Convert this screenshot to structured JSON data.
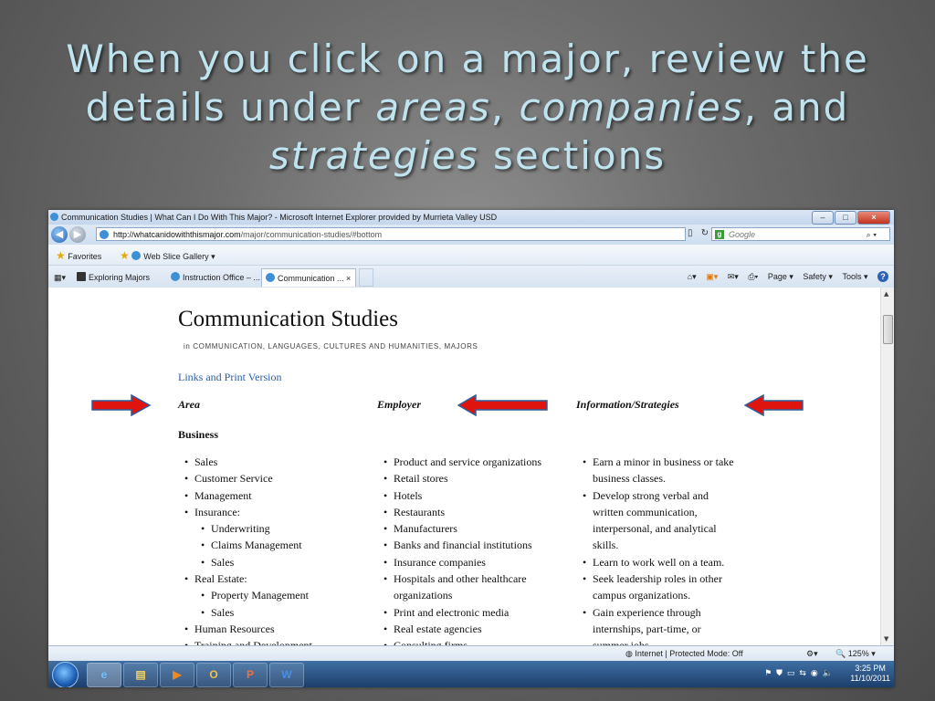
{
  "slide": {
    "title_part1": "When you click on a major, review the details under ",
    "title_areas": "areas",
    "title_comma": ", ",
    "title_companies": "companies",
    "title_and": ", and ",
    "title_strategies": "strategies",
    "title_end": " sections"
  },
  "browser": {
    "window_title": "Communication Studies | What Can I Do With This Major? - Microsoft Internet Explorer provided by Murrieta Valley USD",
    "url_domain": "http://whatcanidowiththismajor.com",
    "url_path": "/major/communication-studies/#bottom",
    "search_placeholder": "Google",
    "favorites_label": "Favorites",
    "web_slice_label": "Web Slice Gallery ▾",
    "tabs": [
      {
        "label": "Exploring Majors"
      },
      {
        "label": "Instruction Office – ..."
      },
      {
        "label": "Communication ...",
        "close": "×"
      }
    ],
    "commands": {
      "page": "Page ▾",
      "safety": "Safety ▾",
      "tools": "Tools ▾",
      "help": "?"
    },
    "status": {
      "zone": "Internet | Protected Mode: Off",
      "zoom": "125%"
    }
  },
  "page": {
    "heading": "Communication Studies",
    "subheading": "in COMMUNICATION, LANGUAGES, CULTURES AND HUMANITIES, MAJORS",
    "links": "Links and Print Version",
    "col_area": "Area",
    "col_employer": "Employer",
    "col_info": "Information/Strategies",
    "section": "Business",
    "area_items": [
      "Sales",
      "Customer Service",
      "Management",
      "Insurance:",
      "Underwriting",
      "Claims Management",
      "Sales",
      "Real Estate:",
      "Property Management",
      "Sales",
      "Human Resources",
      "Training and Development"
    ],
    "employer_items": [
      "Product and service organizations",
      "Retail stores",
      "Hotels",
      "Restaurants",
      "Manufacturers",
      "Banks and financial institutions",
      "Insurance companies",
      "Hospitals and other healthcare",
      "organizations",
      "Print and electronic media",
      "Real estate agencies",
      "Consulting firms"
    ],
    "info_items": [
      "Earn a minor in business or take",
      "business classes.",
      "Develop strong verbal and",
      "written communication,",
      "interpersonal, and analytical",
      "skills.",
      "Learn to work well on a team.",
      "Seek leadership roles in other",
      "campus organizations.",
      "Gain experience through",
      "internships, part-time, or",
      "summer jobs."
    ]
  },
  "taskbar": {
    "time": "3:25 PM",
    "date": "11/10/2011",
    "apps": [
      "IE",
      "Explorer",
      "Media",
      "Outlook",
      "PowerPoint",
      "Word"
    ]
  },
  "colors": {
    "arrow_red": "#e0140f",
    "arrow_outline": "#2e5f9e",
    "link_blue": "#2a5da8",
    "title_blue": "#bfe4f0"
  }
}
